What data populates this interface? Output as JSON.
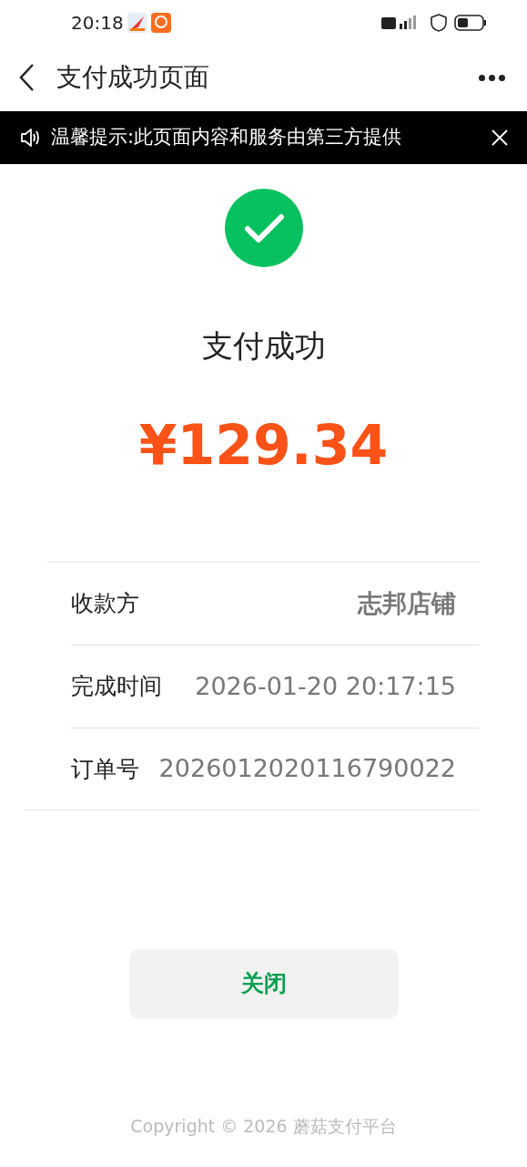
{
  "status_bar": {
    "time": "20:18"
  },
  "nav": {
    "title": "支付成功页面"
  },
  "notice": {
    "text": "温馨提示:此页面内容和服务由第三方提供"
  },
  "result": {
    "status": "支付成功",
    "amount": "¥129.34"
  },
  "details": [
    {
      "label": "收款方",
      "value": "志邦店铺",
      "emphasis": true
    },
    {
      "label": "完成时间",
      "value": "2026-01-20 20:17:15",
      "emphasis": false
    },
    {
      "label": "订单号",
      "value": "2026012020116790022",
      "emphasis": false
    }
  ],
  "close_button": {
    "label": "关闭"
  },
  "footer": {
    "text": "Copyright © 2026 蘑菇支付平台"
  }
}
